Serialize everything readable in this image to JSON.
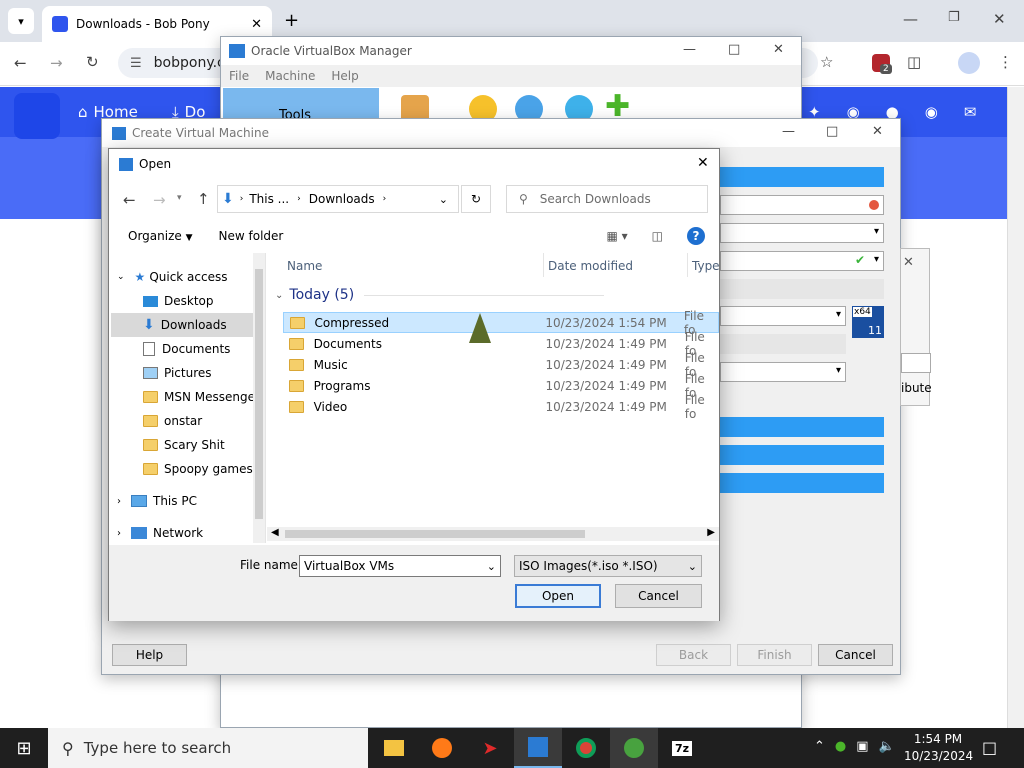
{
  "browser": {
    "tab_title": "Downloads - Bob Pony",
    "url": "bobpony.c",
    "extension_badge": "2"
  },
  "site": {
    "nav_home": "Home",
    "nav_partial": "Do"
  },
  "vbox_manager": {
    "title": "Oracle VirtualBox Manager",
    "menu": [
      "File",
      "Machine",
      "Help"
    ],
    "tools_label": "Tools"
  },
  "create_vm": {
    "title": "Create Virtual Machine",
    "partial_text": "ibute",
    "badge_top": "x64",
    "badge_bottom": "11",
    "buttons": {
      "help": "Help",
      "back": "Back",
      "finish": "Finish",
      "cancel": "Cancel"
    }
  },
  "open_dialog": {
    "title": "Open",
    "breadcrumb": [
      "This ...",
      "Downloads"
    ],
    "search_placeholder": "Search Downloads",
    "organize": "Organize",
    "new_folder": "New folder",
    "nav": {
      "quick_access": "Quick access",
      "items": [
        "Desktop",
        "Downloads",
        "Documents",
        "Pictures",
        "MSN Messenger",
        "onstar",
        "Scary Shit",
        "Spoopy games"
      ],
      "this_pc": "This PC",
      "network": "Network"
    },
    "columns": {
      "name": "Name",
      "date": "Date modified",
      "type": "Type"
    },
    "group": "Today (5)",
    "files": [
      {
        "name": "Compressed",
        "date": "10/23/2024 1:54 PM",
        "type": "File fo"
      },
      {
        "name": "Documents",
        "date": "10/23/2024 1:49 PM",
        "type": "File fo"
      },
      {
        "name": "Music",
        "date": "10/23/2024 1:49 PM",
        "type": "File fo"
      },
      {
        "name": "Programs",
        "date": "10/23/2024 1:49 PM",
        "type": "File fo"
      },
      {
        "name": "Video",
        "date": "10/23/2024 1:49 PM",
        "type": "File fo"
      }
    ],
    "file_name_label": "File name:",
    "file_name_value": "VirtualBox VMs",
    "filter": "ISO Images(*.iso *.ISO)",
    "open_button": "Open",
    "cancel_button": "Cancel"
  },
  "taskbar": {
    "search_placeholder": "Type here to search",
    "time": "1:54 PM",
    "date": "10/23/2024"
  },
  "colors": {
    "accent": "#2d9cf4",
    "site_blue": "#4a6cf7",
    "selection": "#cce8ff"
  }
}
